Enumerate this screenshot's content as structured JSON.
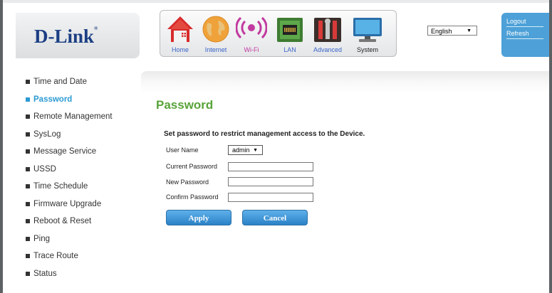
{
  "brand": {
    "logo": "D-Link",
    "reg": "®"
  },
  "nav": [
    {
      "label": "Home",
      "icon": "house-icon"
    },
    {
      "label": "Internet",
      "icon": "globe-icon"
    },
    {
      "label": "Wi-Fi",
      "icon": "wifi-icon"
    },
    {
      "label": "LAN",
      "icon": "lan-icon"
    },
    {
      "label": "Advanced",
      "icon": "tools-icon"
    },
    {
      "label": "System",
      "icon": "monitor-icon"
    }
  ],
  "language": {
    "selected": "English"
  },
  "account": {
    "logout": "Logout",
    "refresh": "Refresh"
  },
  "sidebar": {
    "items": [
      {
        "label": "Time and Date"
      },
      {
        "label": "Password",
        "active": true
      },
      {
        "label": "Remote Management"
      },
      {
        "label": "SysLog"
      },
      {
        "label": "Message Service"
      },
      {
        "label": "USSD"
      },
      {
        "label": "Time Schedule"
      },
      {
        "label": "Firmware Upgrade"
      },
      {
        "label": "Reboot & Reset"
      },
      {
        "label": "Ping"
      },
      {
        "label": "Trace Route"
      },
      {
        "label": "Status"
      }
    ]
  },
  "page": {
    "title": "Password",
    "description": "Set password to restrict management access to the Device.",
    "fields": {
      "user_name_label": "User Name",
      "user_name_value": "admin",
      "current_password_label": "Current Password",
      "new_password_label": "New Password",
      "confirm_password_label": "Confirm Password"
    },
    "buttons": {
      "apply": "Apply",
      "cancel": "Cancel"
    }
  },
  "colors": {
    "accent_blue": "#2c9ad3",
    "title_green": "#59a33b",
    "brand_navy": "#1b3f84",
    "home_red": "#d82b2b",
    "label_red": "#d83a3a",
    "label_blue": "#3a64c8",
    "label_magenta": "#c23aa0",
    "label_green": "#3a9a3a",
    "label_purple": "#7a3ac0"
  }
}
